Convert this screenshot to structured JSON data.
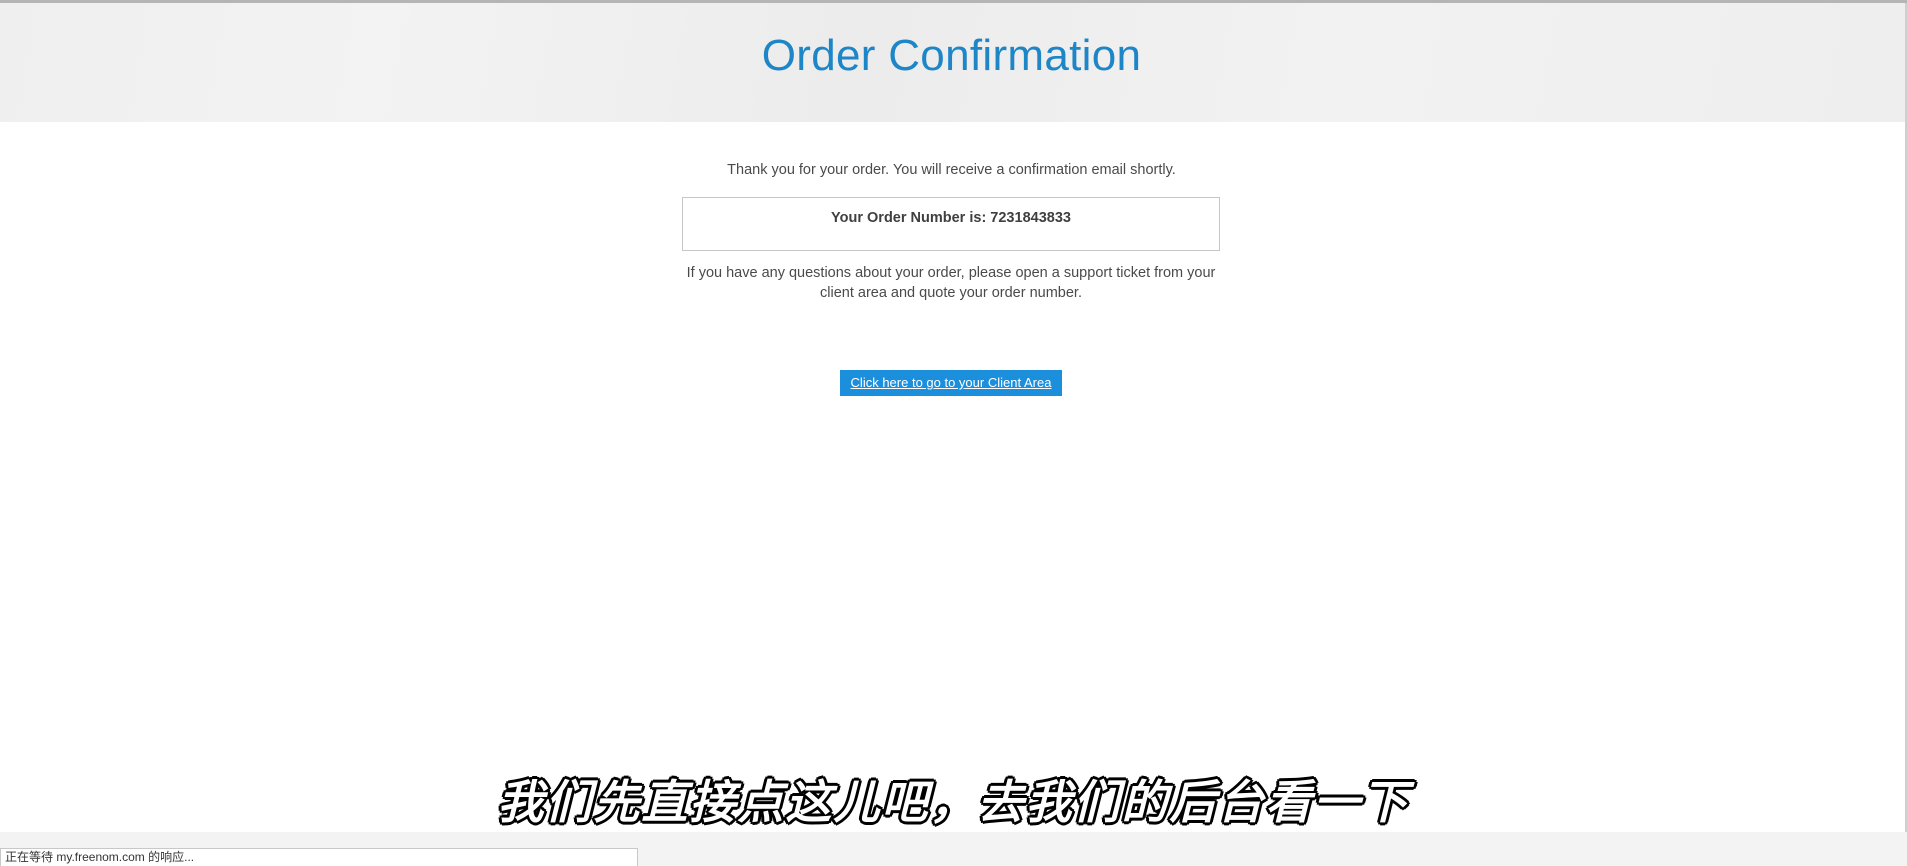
{
  "header": {
    "title": "Order Confirmation"
  },
  "main": {
    "thanks_text": "Thank you for your order. You will receive a confirmation email shortly.",
    "order_number_text": "Your Order Number is: 7231843833",
    "questions_line1": "If you have any questions about your order, please open a support ticket from your",
    "questions_line2": "client area and quote your order number.",
    "client_area_link": "Click here to go to your Client Area"
  },
  "subtitle": "我们先直接点这儿吧，去我们的后台看一下",
  "status_bar": "正在等待 my.freenom.com 的响应...",
  "colors": {
    "title": "#1e86c6",
    "button_bg": "#1c8fdc",
    "header_bg": "#efefef"
  }
}
